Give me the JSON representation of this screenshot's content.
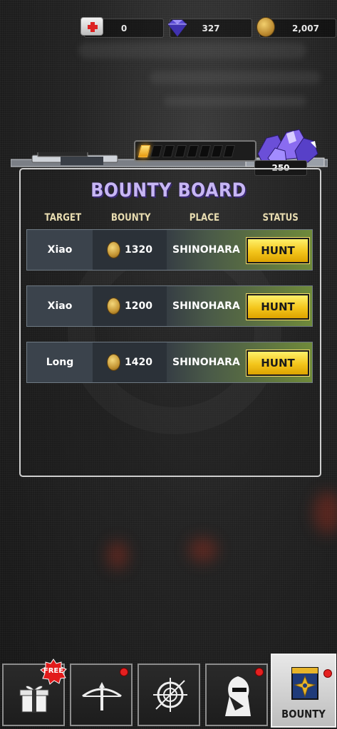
{
  "currencies": {
    "medkits": "0",
    "gems": "327",
    "coins": "2,007"
  },
  "header": {
    "gem_reward": "250",
    "power_level": 1,
    "power_segments": 8
  },
  "board": {
    "title": "BOUNTY BOARD",
    "columns": [
      "TARGET",
      "BOUNTY",
      "PLACE",
      "STATUS"
    ],
    "rows": [
      {
        "target": "Xiao",
        "bounty": "1320",
        "place": "SHINOHARA",
        "status": "HUNT"
      },
      {
        "target": "Xiao",
        "bounty": "1200",
        "place": "SHINOHARA",
        "status": "HUNT"
      },
      {
        "target": "Long",
        "bounty": "1420",
        "place": "SHINOHARA",
        "status": "HUNT"
      }
    ]
  },
  "nav": {
    "free_badge": "FREE",
    "active_label": "BOUNTY",
    "tabs": [
      {
        "icon": "gift-icon",
        "notify": false
      },
      {
        "icon": "crossbow-icon",
        "notify": true
      },
      {
        "icon": "crosshair-icon",
        "notify": false
      },
      {
        "icon": "ninja-icon",
        "notify": true
      },
      {
        "icon": "bounty-poster-icon",
        "notify": true
      }
    ]
  },
  "colors": {
    "title": "#c7b6f4",
    "hunt_button": "#f3c51b",
    "notify_dot": "#e52020"
  }
}
